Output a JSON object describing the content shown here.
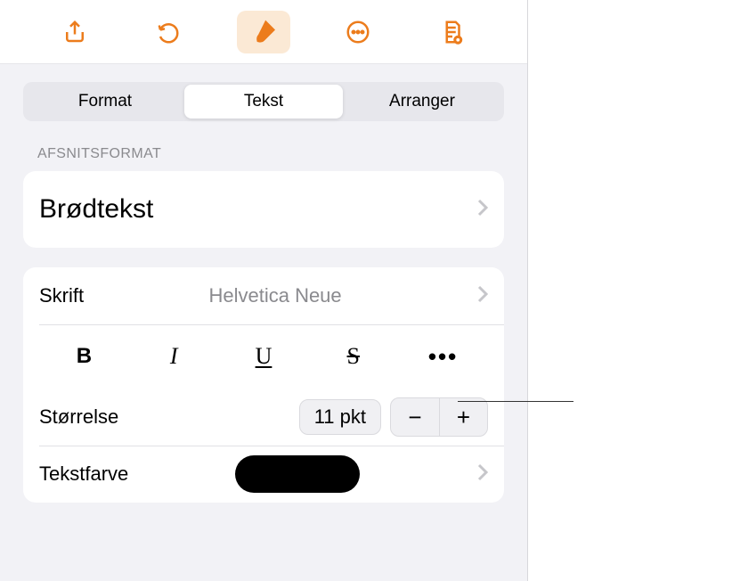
{
  "toolbar": {
    "icons": [
      "share",
      "undo",
      "brush",
      "more",
      "doc-inspect"
    ]
  },
  "tabs": {
    "items": [
      "Format",
      "Tekst",
      "Arranger"
    ],
    "selected": 1
  },
  "section": {
    "header": "AFSNITSFORMAT"
  },
  "paragraph": {
    "style": "Brødtekst"
  },
  "font": {
    "label": "Skrift",
    "value": "Helvetica Neue"
  },
  "styles": {
    "bold": "B",
    "italic": "I",
    "underline": "U",
    "strike": "S",
    "more": "•••"
  },
  "size": {
    "label": "Størrelse",
    "value": "11 pkt",
    "minus": "−",
    "plus": "+"
  },
  "color": {
    "label": "Tekstfarve",
    "value": "#000000"
  }
}
